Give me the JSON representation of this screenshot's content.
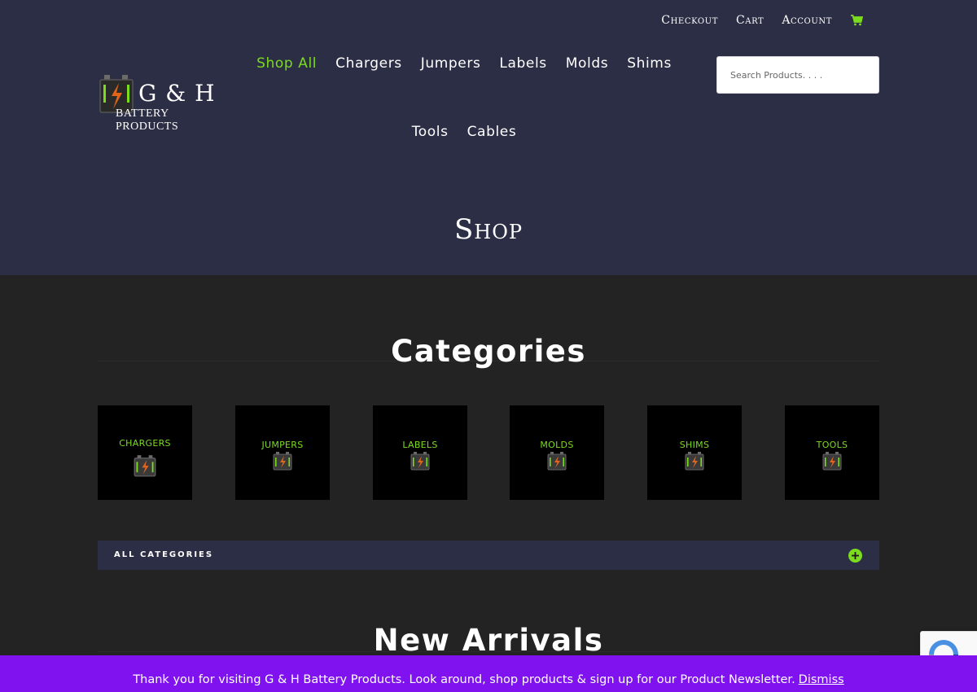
{
  "header": {
    "top_links": [
      "Checkout",
      "Cart",
      "Account"
    ],
    "cart_icon": "cart-icon",
    "logo": {
      "title": "G & H",
      "subtitle": "BATTERY PRODUCTS"
    },
    "nav_row1": [
      "Shop All",
      "Chargers",
      "Jumpers",
      "Labels",
      "Molds",
      "Shims"
    ],
    "nav_row2": [
      "Tools",
      "Cables"
    ],
    "search": {
      "placeholder": "Search Products. . . ."
    },
    "page_title": "Shop"
  },
  "categories": {
    "title": "Categories",
    "tiles": [
      "CHARGERS",
      "JUMPERS",
      "LABELS",
      "MOLDS",
      "SHIMS",
      "TOOLS"
    ],
    "all_categories_label": "ALL CATEGORIES",
    "toggle_icon": "plus-circle-icon"
  },
  "new_arrivals": {
    "title": "New Arrivals"
  },
  "banner": {
    "text": "Thank you for visiting G & H Battery Products. Look around, shop products & sign up for our Product Newsletter.",
    "dismiss": "Dismiss"
  },
  "colors": {
    "header_bg": "#2c2e45",
    "body_bg": "#232323",
    "accent_green": "#7bdc1e",
    "banner_purple": "#7f12ee"
  }
}
